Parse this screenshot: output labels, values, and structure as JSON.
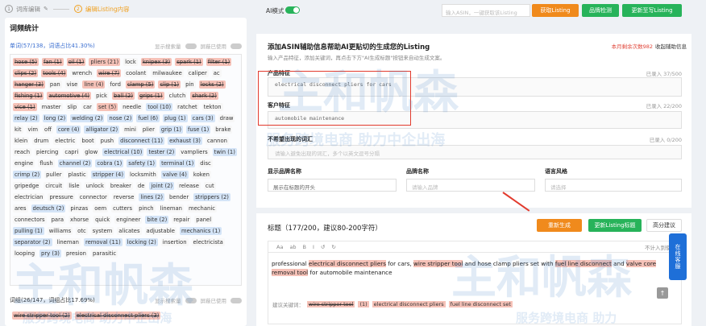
{
  "steps": [
    {
      "num": "1",
      "label": "词库编辑"
    },
    {
      "num": "2",
      "label": "编辑Listing内容"
    }
  ],
  "left": {
    "title": "词频统计",
    "sec1": {
      "label": "单词(57/138，词语占比41.30%)",
      "opt1": "显示搜索量",
      "opt2": "屏蔽已使用"
    },
    "keywords": [
      {
        "t": "hose (5)",
        "c": "red"
      },
      {
        "t": "fan (1)",
        "c": "red"
      },
      {
        "t": "oil (1)",
        "c": "red"
      },
      {
        "t": "pliers (21)",
        "c": "red2"
      },
      {
        "t": "lock",
        "c": "plain"
      },
      {
        "t": "knipex (3)",
        "c": "red"
      },
      {
        "t": "spark (1)",
        "c": "red"
      },
      {
        "t": "filter (1)",
        "c": "red"
      },
      {
        "t": "clips (2)",
        "c": "red"
      },
      {
        "t": "tools (4)",
        "c": "red"
      },
      {
        "t": "wrench",
        "c": "plain"
      },
      {
        "t": "wire (7)",
        "c": "red"
      },
      {
        "t": "coolant",
        "c": "plain"
      },
      {
        "t": "milwaukee",
        "c": "plain"
      },
      {
        "t": "caliper",
        "c": "plain"
      },
      {
        "t": "ac",
        "c": "plain"
      },
      {
        "t": "hanger (3)",
        "c": "red"
      },
      {
        "t": "pan",
        "c": "plain"
      },
      {
        "t": "vise",
        "c": "plain"
      },
      {
        "t": "line (4)",
        "c": "red2"
      },
      {
        "t": "ford",
        "c": "plain"
      },
      {
        "t": "clamp (5)",
        "c": "red"
      },
      {
        "t": "clip (1)",
        "c": "red"
      },
      {
        "t": "pin",
        "c": "plain"
      },
      {
        "t": "locks (2)",
        "c": "red"
      },
      {
        "t": "fishing (1)",
        "c": "red"
      },
      {
        "t": "automotive (4)",
        "c": "red"
      },
      {
        "t": "pick",
        "c": "plain"
      },
      {
        "t": "ball (2)",
        "c": "red"
      },
      {
        "t": "grips (1)",
        "c": "red"
      },
      {
        "t": "clutch",
        "c": "plain"
      },
      {
        "t": "shark (2)",
        "c": "red"
      },
      {
        "t": "vice (1)",
        "c": "red"
      },
      {
        "t": "master",
        "c": "plain"
      },
      {
        "t": "slip",
        "c": "plain"
      },
      {
        "t": "car",
        "c": "plain"
      },
      {
        "t": "set (5)",
        "c": "red2"
      },
      {
        "t": "needle",
        "c": "plain"
      },
      {
        "t": "tool (10)",
        "c": "blue"
      },
      {
        "t": "ratchet",
        "c": "plain"
      },
      {
        "t": "tekton",
        "c": "plain"
      },
      {
        "t": "relay (2)",
        "c": "blue"
      },
      {
        "t": "long (2)",
        "c": "blue"
      },
      {
        "t": "welding (2)",
        "c": "blue"
      },
      {
        "t": "nose (2)",
        "c": "blue"
      },
      {
        "t": "fuel (6)",
        "c": "blue"
      },
      {
        "t": "plug (1)",
        "c": "blue"
      },
      {
        "t": "cars (3)",
        "c": "blue"
      },
      {
        "t": "draw",
        "c": "plain"
      },
      {
        "t": "kit",
        "c": "plain"
      },
      {
        "t": "vim",
        "c": "plain"
      },
      {
        "t": "off",
        "c": "plain"
      },
      {
        "t": "core (4)",
        "c": "blue"
      },
      {
        "t": "alligator (2)",
        "c": "blue"
      },
      {
        "t": "mini",
        "c": "plain"
      },
      {
        "t": "plier",
        "c": "plain"
      },
      {
        "t": "grip (1)",
        "c": "blue"
      },
      {
        "t": "fuse (1)",
        "c": "blue"
      },
      {
        "t": "brake",
        "c": "plain"
      },
      {
        "t": "klein",
        "c": "plain"
      },
      {
        "t": "drum",
        "c": "plain"
      },
      {
        "t": "electric",
        "c": "plain"
      },
      {
        "t": "boot",
        "c": "plain"
      },
      {
        "t": "push",
        "c": "plain"
      },
      {
        "t": "disconnect (11)",
        "c": "blue"
      },
      {
        "t": "exhaust (3)",
        "c": "blue"
      },
      {
        "t": "cannon",
        "c": "plain"
      },
      {
        "t": "reach",
        "c": "plain"
      },
      {
        "t": "piercing",
        "c": "plain"
      },
      {
        "t": "capri",
        "c": "plain"
      },
      {
        "t": "glow",
        "c": "plain"
      },
      {
        "t": "electrical (10)",
        "c": "blue"
      },
      {
        "t": "tester (2)",
        "c": "blue"
      },
      {
        "t": "vampliers",
        "c": "plain"
      },
      {
        "t": "twin (1)",
        "c": "blue"
      },
      {
        "t": "engine",
        "c": "plain"
      },
      {
        "t": "flush",
        "c": "plain"
      },
      {
        "t": "channel (2)",
        "c": "blue"
      },
      {
        "t": "cobra (1)",
        "c": "blue"
      },
      {
        "t": "safety (1)",
        "c": "blue"
      },
      {
        "t": "terminal (1)",
        "c": "blue"
      },
      {
        "t": "disc",
        "c": "plain"
      },
      {
        "t": "crimp (2)",
        "c": "blue"
      },
      {
        "t": "puller",
        "c": "plain"
      },
      {
        "t": "plastic",
        "c": "plain"
      },
      {
        "t": "stripper (4)",
        "c": "blue"
      },
      {
        "t": "locksmith",
        "c": "plain"
      },
      {
        "t": "valve (4)",
        "c": "blue"
      },
      {
        "t": "koken",
        "c": "plain"
      },
      {
        "t": "gripedge",
        "c": "plain"
      },
      {
        "t": "circuit",
        "c": "plain"
      },
      {
        "t": "lisle",
        "c": "plain"
      },
      {
        "t": "unlock",
        "c": "plain"
      },
      {
        "t": "breaker",
        "c": "plain"
      },
      {
        "t": "de",
        "c": "plain"
      },
      {
        "t": "joint (2)",
        "c": "blue"
      },
      {
        "t": "release",
        "c": "plain"
      },
      {
        "t": "cut",
        "c": "plain"
      },
      {
        "t": "electrician",
        "c": "plain"
      },
      {
        "t": "pressure",
        "c": "plain"
      },
      {
        "t": "connector",
        "c": "plain"
      },
      {
        "t": "reverse",
        "c": "plain"
      },
      {
        "t": "lines (2)",
        "c": "blue"
      },
      {
        "t": "bender",
        "c": "plain"
      },
      {
        "t": "strippers (2)",
        "c": "blue"
      },
      {
        "t": "ares",
        "c": "plain"
      },
      {
        "t": "deutsch (2)",
        "c": "blue"
      },
      {
        "t": "pinzas",
        "c": "plain"
      },
      {
        "t": "oem",
        "c": "plain"
      },
      {
        "t": "cutters",
        "c": "plain"
      },
      {
        "t": "pinch",
        "c": "plain"
      },
      {
        "t": "lineman",
        "c": "plain"
      },
      {
        "t": "mechanic",
        "c": "plain"
      },
      {
        "t": "connectors",
        "c": "plain"
      },
      {
        "t": "para",
        "c": "plain"
      },
      {
        "t": "xhorse",
        "c": "plain"
      },
      {
        "t": "quick",
        "c": "plain"
      },
      {
        "t": "engineer",
        "c": "plain"
      },
      {
        "t": "bite (2)",
        "c": "blue"
      },
      {
        "t": "repair",
        "c": "plain"
      },
      {
        "t": "panel",
        "c": "plain"
      },
      {
        "t": "pulling (1)",
        "c": "blue"
      },
      {
        "t": "williams",
        "c": "plain"
      },
      {
        "t": "otc",
        "c": "plain"
      },
      {
        "t": "system",
        "c": "plain"
      },
      {
        "t": "alicates",
        "c": "plain"
      },
      {
        "t": "adjustable",
        "c": "plain"
      },
      {
        "t": "mechanics (1)",
        "c": "blue"
      },
      {
        "t": "separator (2)",
        "c": "blue"
      },
      {
        "t": "lineman",
        "c": "plain"
      },
      {
        "t": "removal (11)",
        "c": "blue"
      },
      {
        "t": "locking (2)",
        "c": "blue"
      },
      {
        "t": "insertion",
        "c": "plain"
      },
      {
        "t": "electricista",
        "c": "plain"
      },
      {
        "t": "looping",
        "c": "plain"
      },
      {
        "t": "pry (3)",
        "c": "blue"
      },
      {
        "t": "presion",
        "c": "plain"
      },
      {
        "t": "parasitic",
        "c": "plain"
      }
    ],
    "sec2": {
      "label": "词组(26/147，词组占比17.69%)",
      "opt1": "显示搜索量",
      "opt2": "屏蔽已使用"
    },
    "phrases": [
      {
        "t": "wire stripper tool (2)",
        "c": "red"
      },
      {
        "t": "electrical disconnect pliers (3)",
        "c": "red"
      }
    ]
  },
  "top": {
    "ai_label": "AI模式",
    "asin_placeholder": "输入ASIN，一键获取该Listing",
    "btn_get": "获取Listing",
    "btn_brand": "品牌检测",
    "btn_update": "更新至写Listing"
  },
  "form": {
    "title": "添加ASIN辅助信息帮助AI更贴切的生成您的Listing",
    "subtitle": "输入产品特征，添加关键词，再点击下方\"AI生成标题\"按钮来自动生成文案。",
    "remain": "本月剩余次数982",
    "collapse": "收起辅助信息",
    "f1_label": "产品特征",
    "f1_count": "已录入 37/500",
    "f1_value": "electrical disconnect pliers for cars",
    "f2_label": "客户特征",
    "f2_count": "已录入 22/200",
    "f2_value": "automobile maintenance",
    "f3_label": "不希望出现的词汇",
    "f3_count": "已录入 0/200",
    "f3_placeholder": "请输入避免出现的词汇，多个以英文逗号分隔",
    "s1_label": "显示品牌名称",
    "s1_value": "展示在标题的开头",
    "s2_label": "品牌名称",
    "s2_placeholder": "请输入品牌",
    "s3_label": "语言风格",
    "s3_placeholder": "请选择"
  },
  "title_card": {
    "label": "标题（177/200，建议80-200字符）",
    "btn_regen": "重新生成",
    "btn_check": "更新Listing标题",
    "btn_advice": "高分建议",
    "toolbar": [
      "Aa",
      "ab",
      "B",
      "I",
      "↺",
      "↻"
    ],
    "toolbar_right": "不计入到使用",
    "text_parts": [
      {
        "t": "professional ",
        "h": false
      },
      {
        "t": "electrical disconnect pliers",
        "h": true
      },
      {
        "t": " for cars, ",
        "h": false
      },
      {
        "t": "wire stripper tool",
        "h": true
      },
      {
        "t": " and hose clamp pliers set with ",
        "h": false
      },
      {
        "t": "fuel line disconnect",
        "h": true
      },
      {
        "t": " and ",
        "h": false
      },
      {
        "t": "valve core removal tool",
        "h": true
      },
      {
        "t": " for automobile maintenance",
        "h": false
      }
    ],
    "kw_label": "建议关键词：",
    "kw": [
      {
        "t": "wire stripper tool",
        "s": true
      },
      {
        "t": "(1)",
        "s": false
      },
      {
        "t": "electrical disconnect pliers",
        "s": false
      },
      {
        "t": "fuel line disconnect set",
        "s": false
      }
    ]
  },
  "side": {
    "widget": "在线客服",
    "scroll": "↑"
  },
  "watermark": {
    "cn": "主和帆森",
    "tag": "服务跨境电商  助力中企出海",
    "tag2": "服务跨境电商  助力"
  }
}
